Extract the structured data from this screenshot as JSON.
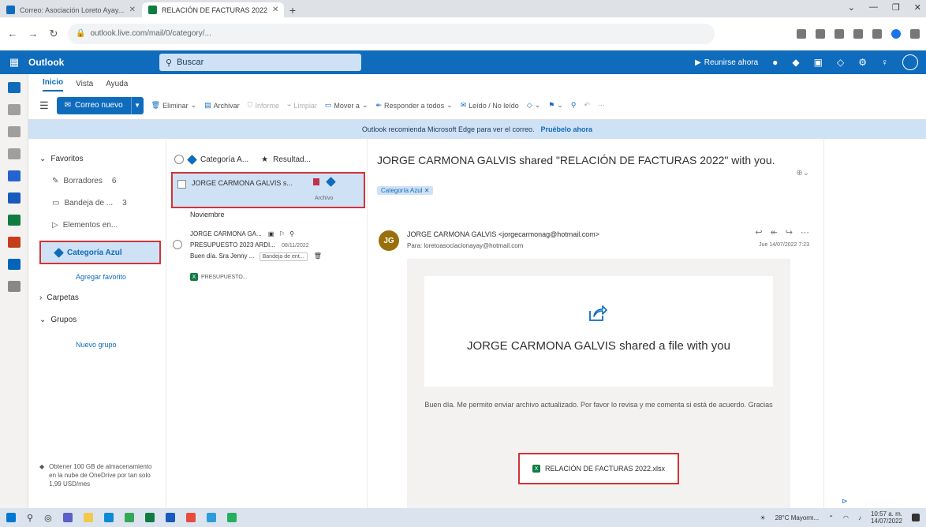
{
  "browser": {
    "tabs": [
      {
        "title": "Correo: Asociación Loreto Ayay...",
        "active": false,
        "favicon": "outlook-favicon"
      },
      {
        "title": "RELACIÓN DE FACTURAS 2022",
        "active": true,
        "favicon": "excel-favicon"
      }
    ],
    "new_tab_label": "+",
    "url": "outlook.live.com/mail/0/category/..."
  },
  "suite": {
    "app_name": "Outlook",
    "search_placeholder": "Buscar",
    "meet_label": "Reunirse ahora"
  },
  "ribbon": {
    "tabs": [
      "Inicio",
      "Vista",
      "Ayuda"
    ],
    "new_mail_label": "Correo nuevo",
    "buttons": [
      {
        "label": "Eliminar",
        "disabled": false
      },
      {
        "label": "Archivar",
        "disabled": false
      },
      {
        "label": "Informe",
        "disabled": true
      },
      {
        "label": "Limpiar",
        "disabled": true
      },
      {
        "label": "Mover a",
        "disabled": false
      },
      {
        "label": "Responder a todos",
        "disabled": false
      },
      {
        "label": "Leído / No leído",
        "disabled": false
      }
    ]
  },
  "banner": {
    "text": "Outlook recomienda Microsoft Edge para ver el correo.",
    "link": "Pruébelo ahora"
  },
  "folders": {
    "favorites_label": "Favoritos",
    "items": [
      {
        "label": "Borradores",
        "count": "6"
      },
      {
        "label": "Bandeja de ...",
        "count": "3"
      },
      {
        "label": "Elementos en...",
        "count": ""
      }
    ],
    "selected_label": "Categoría Azul",
    "add_favorite": "Agregar favorito",
    "folders_label": "Carpetas",
    "groups_label": "Grupos",
    "new_group": "Nuevo grupo",
    "storage_text": "Obtener 100 GB de almacenamiento en la nube de OneDrive por tan solo 1,99 USD/mes"
  },
  "message_list": {
    "header_category": "Categoría A...",
    "header_results": "Resultad...",
    "selected_message": {
      "from": "JORGE CARMONA GALVIS s...",
      "footer": "Archivo"
    },
    "group_label": "Noviembre",
    "message2": {
      "from": "JORGE CARMONA GA...",
      "subject": "PRESUPUESTO 2023 ARDI...",
      "date": "08/11/2022",
      "preview": "Buen día. Sra Jenny ...",
      "chip": "Bandeja de ent...",
      "attachment": "PRESUPUESTO..."
    }
  },
  "reading": {
    "subject": "JORGE CARMONA GALVIS shared \"RELACIÓN DE FACTURAS 2022\" with you.",
    "category_tag": "Categoría Azul",
    "sender_initials": "JG",
    "sender_name": "JORGE CARMONA GALVIS <jorgecarmonag@hotmail.com>",
    "sender_to": "Para: loretoasociacionayay@hotmail.com",
    "date": "Jue 14/07/2022 7:23",
    "card_title": "JORGE CARMONA GALVIS shared a file with you",
    "body": "Buen día. Me permito enviar archivo actualizado. Por favor lo revisa y me comenta si está de acuerdo. Gracias",
    "file_name": "RELACIÓN DE FACTURAS 2022.xlsx"
  },
  "taskbar": {
    "weather": "28°C Mayorm...",
    "time": "10:57 a. m.",
    "date": "14/07/2022"
  },
  "colors": {
    "accent": "#0f6cbd",
    "highlight": "#d13438",
    "selection": "#cfe1f5",
    "excel": "#107c41"
  }
}
